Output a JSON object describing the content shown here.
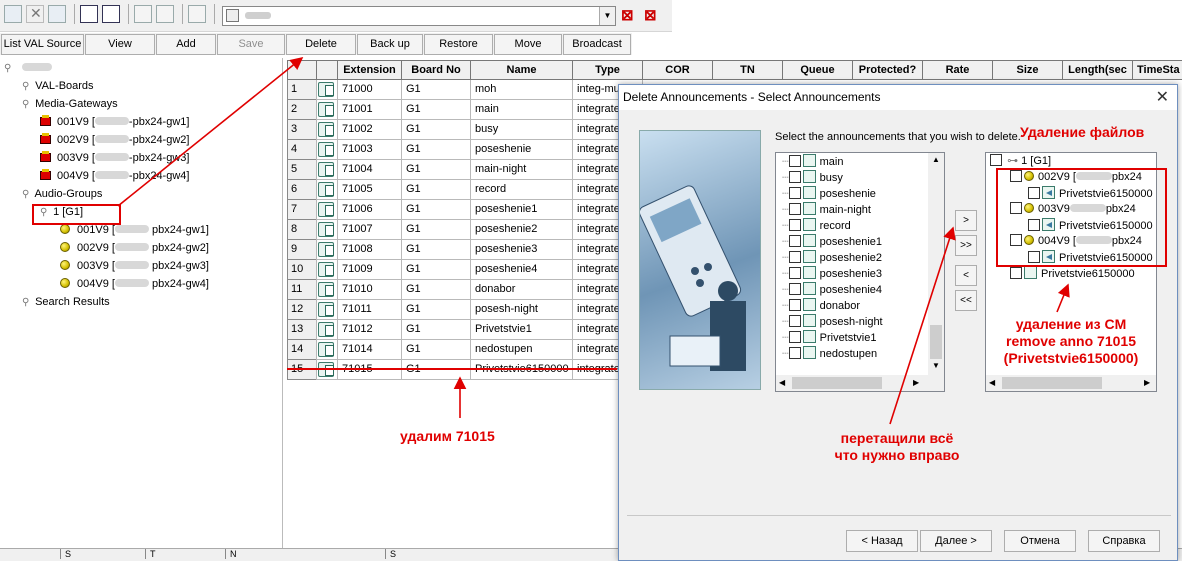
{
  "toolbar": {
    "combo_blur": "",
    "combo_arrow": "▼"
  },
  "buttons": [
    "List VAL Source",
    "View",
    "Add",
    "Save",
    "Delete",
    "Back up",
    "Restore",
    "Move",
    "Broadcast"
  ],
  "tree": {
    "root_blur": "",
    "val_boards": "VAL-Boards",
    "media_gateways": "Media-Gateways",
    "gateways": [
      {
        "id": "001V9 [",
        "suffix": "-pbx24-gw1]"
      },
      {
        "id": "002V9 [",
        "suffix": "-pbx24-gw2]"
      },
      {
        "id": "003V9 [",
        "suffix": "-pbx24-gw3]"
      },
      {
        "id": "004V9 [",
        "suffix": "-pbx24-gw4]"
      }
    ],
    "audio_groups": "Audio-Groups",
    "group1": "1 [G1]",
    "group_members": [
      {
        "id": "001V9",
        "suffix": "pbx24-gw1]"
      },
      {
        "id": "002V9",
        "suffix": "pbx24-gw2]"
      },
      {
        "id": "003V9",
        "suffix": "pbx24-gw3]"
      },
      {
        "id": "004V9",
        "suffix": "pbx24-gw4]"
      }
    ],
    "search_results": "Search Results"
  },
  "grid": {
    "headers": [
      "Extension",
      "Board No",
      "Name",
      "Type",
      "COR",
      "TN",
      "Queue",
      "Protected?",
      "Rate",
      "Size",
      "Length(sec",
      "TimeSta"
    ],
    "rows": [
      {
        "n": "1",
        "ext": "71000",
        "board": "G1",
        "name": "moh",
        "type": "integ-mus"
      },
      {
        "n": "2",
        "ext": "71001",
        "board": "G1",
        "name": "main",
        "type": "integrated"
      },
      {
        "n": "3",
        "ext": "71002",
        "board": "G1",
        "name": "busy",
        "type": "integrated"
      },
      {
        "n": "4",
        "ext": "71003",
        "board": "G1",
        "name": "poseshenie",
        "type": "integrated"
      },
      {
        "n": "5",
        "ext": "71004",
        "board": "G1",
        "name": "main-night",
        "type": "integrated"
      },
      {
        "n": "6",
        "ext": "71005",
        "board": "G1",
        "name": "record",
        "type": "integrated"
      },
      {
        "n": "7",
        "ext": "71006",
        "board": "G1",
        "name": "poseshenie1",
        "type": "integrated"
      },
      {
        "n": "8",
        "ext": "71007",
        "board": "G1",
        "name": "poseshenie2",
        "type": "integrated"
      },
      {
        "n": "9",
        "ext": "71008",
        "board": "G1",
        "name": "poseshenie3",
        "type": "integrated"
      },
      {
        "n": "10",
        "ext": "71009",
        "board": "G1",
        "name": "poseshenie4",
        "type": "integrated"
      },
      {
        "n": "11",
        "ext": "71010",
        "board": "G1",
        "name": "donabor",
        "type": "integrated"
      },
      {
        "n": "12",
        "ext": "71011",
        "board": "G1",
        "name": "posesh-night",
        "type": "integrated"
      },
      {
        "n": "13",
        "ext": "71012",
        "board": "G1",
        "name": "Privetstvie1",
        "type": "integrated"
      },
      {
        "n": "14",
        "ext": "71014",
        "board": "G1",
        "name": "nedostupen",
        "type": "integrated"
      },
      {
        "n": "15",
        "ext": "71015",
        "board": "G1",
        "name": "Privetstvie6150000",
        "type": "integrated"
      }
    ]
  },
  "status_cols": [
    "S",
    "T",
    "N",
    "S"
  ],
  "dialog": {
    "title": "Delete Announcements - Select Announcements",
    "close": "✕",
    "instruction": "Select the announcements that you wish to delete.",
    "left_list": [
      "main",
      "busy",
      "poseshenie",
      "main-night",
      "record",
      "poseshenie1",
      "poseshenie2",
      "poseshenie3",
      "poseshenie4",
      "donabor",
      "posesh-night",
      "Privetstvie1",
      "nedostupen"
    ],
    "right_root": "1 [G1]",
    "right_groups": [
      {
        "id": "002V9 [",
        "suffix": "pbx24",
        "file": "Privetstvie6150000"
      },
      {
        "id": "003V9",
        "suffix": "pbx24",
        "file": "Privetstvie6150000"
      },
      {
        "id": "004V9 [",
        "suffix": "pbx24",
        "file": "Privetstvie6150000"
      }
    ],
    "right_extra": "Privetstvie6150000",
    "move_buttons": [
      ">",
      ">>",
      "<",
      "<<"
    ],
    "back": "< Назад",
    "next": "Далее >",
    "cancel": "Отмена",
    "help": "Справка"
  },
  "annotations": {
    "delete_files": "Удаление файлов",
    "remove_cm_1": "удаление из CM",
    "remove_cm_2": "remove anno 71015",
    "remove_cm_3": "(Privetstvie6150000)",
    "delete_ext": "удалим 71015",
    "dragged_1": "перетащили всё",
    "dragged_2": "что нужно вправо"
  }
}
